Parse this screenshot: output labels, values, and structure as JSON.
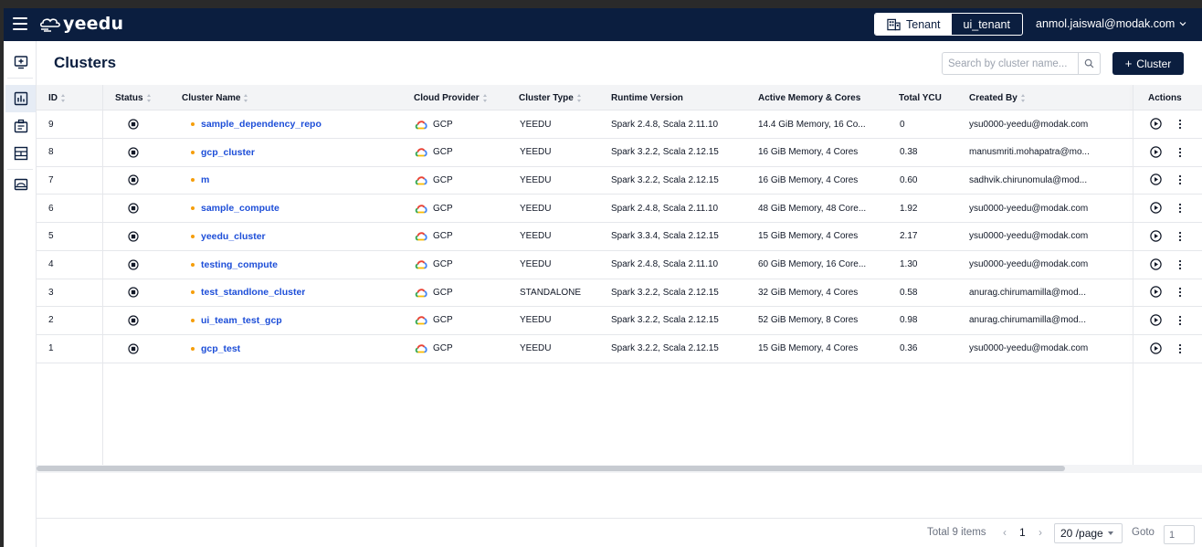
{
  "app": {
    "logo_text": "yeedu"
  },
  "topbar": {
    "tenant_label": "Tenant",
    "tenant_value": "ui_tenant",
    "user_email": "anmol.jaiswal@modak.com"
  },
  "page": {
    "title": "Clusters"
  },
  "search": {
    "placeholder": "Search by cluster name..."
  },
  "toolbar": {
    "add_label": "Cluster"
  },
  "table": {
    "headers": {
      "id": "ID",
      "status": "Status",
      "name": "Cluster Name",
      "cloud": "Cloud Provider",
      "type": "Cluster Type",
      "runtime": "Runtime Version",
      "memory": "Active Memory & Cores",
      "ycu": "Total YCU",
      "created_by": "Created By",
      "actions": "Actions"
    },
    "rows": [
      {
        "id": "9",
        "name": "sample_dependency_repo",
        "cloud": "GCP",
        "type": "YEEDU",
        "runtime": "Spark 2.4.8, Scala 2.11.10",
        "memory": "14.4 GiB Memory, 16 Co...",
        "ycu": "0",
        "created_by": "ysu0000-yeedu@modak.com"
      },
      {
        "id": "8",
        "name": "gcp_cluster",
        "cloud": "GCP",
        "type": "YEEDU",
        "runtime": "Spark 3.2.2, Scala 2.12.15",
        "memory": "16 GiB Memory, 4 Cores",
        "ycu": "0.38",
        "created_by": "manusmriti.mohapatra@mo..."
      },
      {
        "id": "7",
        "name": "m",
        "cloud": "GCP",
        "type": "YEEDU",
        "runtime": "Spark 3.2.2, Scala 2.12.15",
        "memory": "16 GiB Memory, 4 Cores",
        "ycu": "0.60",
        "created_by": "sadhvik.chirunomula@mod..."
      },
      {
        "id": "6",
        "name": "sample_compute",
        "cloud": "GCP",
        "type": "YEEDU",
        "runtime": "Spark 2.4.8, Scala 2.11.10",
        "memory": "48 GiB Memory, 48 Core...",
        "ycu": "1.92",
        "created_by": "ysu0000-yeedu@modak.com"
      },
      {
        "id": "5",
        "name": "yeedu_cluster",
        "cloud": "GCP",
        "type": "YEEDU",
        "runtime": "Spark 3.3.4, Scala 2.12.15",
        "memory": "15 GiB Memory, 4 Cores",
        "ycu": "2.17",
        "created_by": "ysu0000-yeedu@modak.com"
      },
      {
        "id": "4",
        "name": "testing_compute",
        "cloud": "GCP",
        "type": "YEEDU",
        "runtime": "Spark 2.4.8, Scala 2.11.10",
        "memory": "60 GiB Memory, 16 Core...",
        "ycu": "1.30",
        "created_by": "ysu0000-yeedu@modak.com"
      },
      {
        "id": "3",
        "name": "test_standlone_cluster",
        "cloud": "GCP",
        "type": "STANDALONE",
        "runtime": "Spark 3.2.2, Scala 2.12.15",
        "memory": "32 GiB Memory, 4 Cores",
        "ycu": "0.58",
        "created_by": "anurag.chirumamilla@mod..."
      },
      {
        "id": "2",
        "name": "ui_team_test_gcp",
        "cloud": "GCP",
        "type": "YEEDU",
        "runtime": "Spark 3.2.2, Scala 2.12.15",
        "memory": "52 GiB Memory, 8 Cores",
        "ycu": "0.98",
        "created_by": "anurag.chirumamilla@mod..."
      },
      {
        "id": "1",
        "name": "gcp_test",
        "cloud": "GCP",
        "type": "YEEDU",
        "runtime": "Spark 3.2.2, Scala 2.12.15",
        "memory": "15 GiB Memory, 4 Cores",
        "ycu": "0.36",
        "created_by": "ysu0000-yeedu@modak.com"
      }
    ]
  },
  "pagination": {
    "total": "Total 9 items",
    "prev": "‹",
    "next": "›",
    "current_page": "1",
    "per_page": "20 /page",
    "goto_label": "Goto",
    "goto_value": "1"
  },
  "colors": {
    "navy": "#0b1e3f",
    "link": "#1d4ed8",
    "status_dot": "#f59e0b"
  },
  "icons": {
    "sidebar": [
      "add-box-icon",
      "dashboard-chart-icon",
      "workspace-icon",
      "cluster-layout-icon",
      "storage-icon"
    ]
  }
}
